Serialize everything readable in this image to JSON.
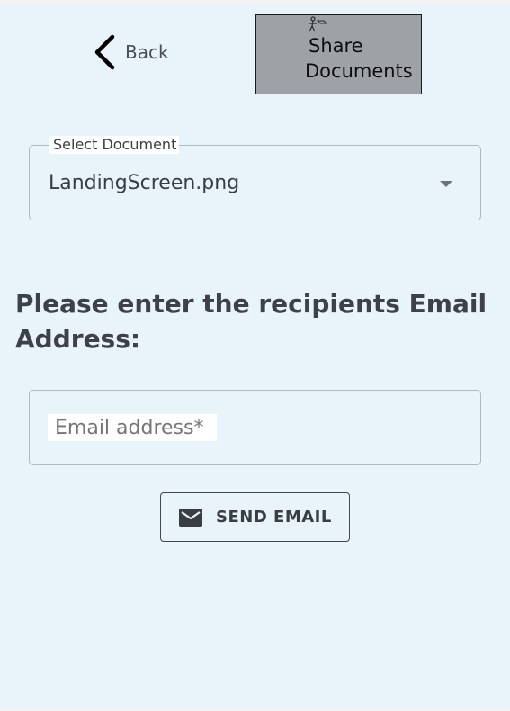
{
  "header": {
    "back_label": "Back",
    "back_icon": "chevron-left-icon",
    "title_line1": "Share",
    "title_line2": "Documents",
    "title_icon": "person-share-icon",
    "title_box_color": "#9ea2a6"
  },
  "document_select": {
    "label": "Select Document",
    "value": "LandingScreen.png",
    "arrow_icon": "dropdown-arrow-icon"
  },
  "recipient": {
    "prompt": "Please enter the recipients Email Address:",
    "email_placeholder": "Email address*",
    "email_value": ""
  },
  "send_button": {
    "label": "SEND EMAIL",
    "icon": "envelope-icon"
  },
  "colors": {
    "background": "#e8f3fa",
    "text": "#3a3d42"
  }
}
